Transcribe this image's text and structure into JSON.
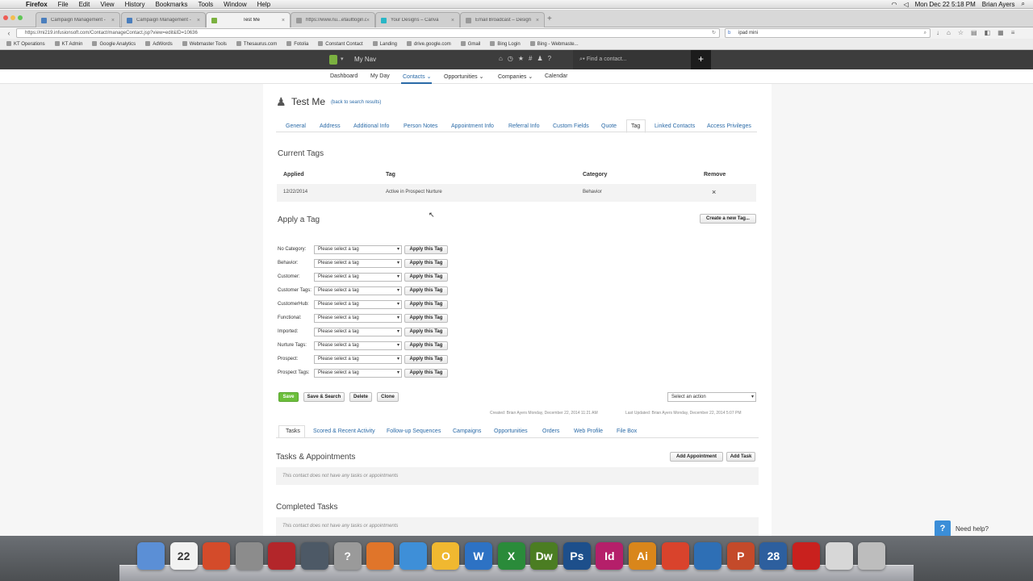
{
  "menubar": {
    "app": "Firefox",
    "items": [
      "File",
      "Edit",
      "View",
      "History",
      "Bookmarks",
      "Tools",
      "Window",
      "Help"
    ],
    "clock": "Mon Dec 22  5:18 PM",
    "user": "Brian Ayers"
  },
  "browser": {
    "tabs": [
      {
        "label": "Campaign Management -",
        "color": "#4a7ebd"
      },
      {
        "label": "Campaign Management -",
        "color": "#4a7ebd"
      },
      {
        "label": "Test Me",
        "color": "#7bb140"
      },
      {
        "label": "https://www.nu...efaultlogin.do",
        "color": "#999999"
      },
      {
        "label": "Your Designs – Canva",
        "color": "#29b6c6"
      },
      {
        "label": "Email Broadcast – Design",
        "color": "#999999"
      }
    ],
    "url": "https://mi219.infusionsoft.com/Contact/manageContact.jsp?view=edit&ID=10636",
    "search_value": "ipad mini",
    "bookmarks": [
      "KT Operations",
      "KT Admin",
      "Google Analytics",
      "AdWords",
      "Webmaster Tools",
      "Thesaurus.com",
      "Fotolia",
      "Constant Contact",
      "Landing",
      "drive.google.com",
      "Gmail",
      "Bing Login",
      "Bing - Webmaste..."
    ]
  },
  "appbar": {
    "title": "My Nav",
    "find_placeholder": "Find a contact...",
    "add_label": "+"
  },
  "mainnav": [
    "Dashboard",
    "My Day",
    "Contacts",
    "Opportunities",
    "Companies",
    "Calendar"
  ],
  "contact": {
    "name": "Test Me",
    "back_link": "(back to search results)"
  },
  "subtabs": [
    "General",
    "Address",
    "Additional Info",
    "Person Notes",
    "Appointment Info",
    "Referral Info",
    "Custom Fields",
    "Quote",
    "Tag",
    "Linked Contacts",
    "Access Privileges"
  ],
  "current_tags": {
    "heading": "Current Tags",
    "columns": [
      "Applied",
      "Tag",
      "Category",
      "Remove"
    ],
    "rows": [
      {
        "applied": "12/22/2014",
        "tag": "Active in Prospect Nurture",
        "category": "Behavior",
        "remove": "×"
      }
    ]
  },
  "apply_tag": {
    "heading": "Apply a Tag",
    "create_button": "Create a new Tag...",
    "select_placeholder": "Please select a tag",
    "apply_button": "Apply this Tag",
    "categories": [
      "No Category:",
      "Behavior:",
      "Customer:",
      "Customer Tags:",
      "CustomerHub:",
      "Functional:",
      "Imported:",
      "Nurture Tags:",
      "Prospect:",
      "Prospect Tags:"
    ]
  },
  "actions": {
    "save": "Save",
    "save_search": "Save & Search",
    "delete": "Delete",
    "clone": "Clone",
    "action_select": "Select an action",
    "created": "Created:  Brian Ayers Monday, December 22, 2014 11:21 AM",
    "updated": "Last Updated:  Brian Ayers Monday, December 22, 2014 5:07 PM"
  },
  "bottom_tabs": [
    "Tasks",
    "Scored & Recent Activity",
    "Follow-up Sequences",
    "Campaigns",
    "Opportunities",
    "Orders",
    "Web Profile",
    "File Box"
  ],
  "tasks": {
    "heading": "Tasks & Appointments",
    "add_appointment": "Add Appointment",
    "add_task": "Add Task",
    "empty": "This contact does not have any tasks or appointments"
  },
  "completed": {
    "heading": "Completed Tasks",
    "empty": "This contact does not have any tasks or appointments"
  },
  "help": {
    "icon": "?",
    "label": "Need help?"
  },
  "dock": [
    {
      "name": "finder-icon",
      "color": "#5b8fd6",
      "glyph": ""
    },
    {
      "name": "calendar-icon",
      "color": "#f2f2f2",
      "glyph": "22"
    },
    {
      "name": "cleaner-icon",
      "color": "#d44b2a",
      "glyph": ""
    },
    {
      "name": "printer-icon",
      "color": "#8c8c8c",
      "glyph": ""
    },
    {
      "name": "photobooth-icon",
      "color": "#b3262a",
      "glyph": ""
    },
    {
      "name": "screenshot-icon",
      "color": "#4d5966",
      "glyph": ""
    },
    {
      "name": "help-icon",
      "color": "#9a9a9a",
      "glyph": "?"
    },
    {
      "name": "firefox-icon",
      "color": "#e0752a",
      "glyph": ""
    },
    {
      "name": "safari-icon",
      "color": "#3e8fd8",
      "glyph": ""
    },
    {
      "name": "mail-icon",
      "color": "#f0b830",
      "glyph": "O"
    },
    {
      "name": "word-icon",
      "color": "#2d72c4",
      "glyph": "W"
    },
    {
      "name": "excel-icon",
      "color": "#2a8b3a",
      "glyph": "X"
    },
    {
      "name": "dreamweaver-icon",
      "color": "#4b7d22",
      "glyph": "Dw"
    },
    {
      "name": "photoshop-icon",
      "color": "#1d4f8b",
      "glyph": "Ps"
    },
    {
      "name": "indesign-icon",
      "color": "#b51f6a",
      "glyph": "Id"
    },
    {
      "name": "illustrator-icon",
      "color": "#d9861b",
      "glyph": "Ai"
    },
    {
      "name": "chrome-icon",
      "color": "#d9432c",
      "glyph": ""
    },
    {
      "name": "network-icon",
      "color": "#2e6fb5",
      "glyph": ""
    },
    {
      "name": "powerpoint-icon",
      "color": "#c44a2a",
      "glyph": "P"
    },
    {
      "name": "clock-icon",
      "color": "#2d5f9e",
      "glyph": "28"
    },
    {
      "name": "acrobat-icon",
      "color": "#c9211e",
      "glyph": ""
    },
    {
      "name": "folder-icon",
      "color": "#d7d7d7",
      "glyph": ""
    },
    {
      "name": "trash-icon",
      "color": "#bdbdbd",
      "glyph": ""
    }
  ],
  "colors": {
    "link": "#2a6aa7",
    "save_green": "#6cbf3b",
    "appbar": "#3d3d3d",
    "help_blue": "#3b8ed8"
  }
}
